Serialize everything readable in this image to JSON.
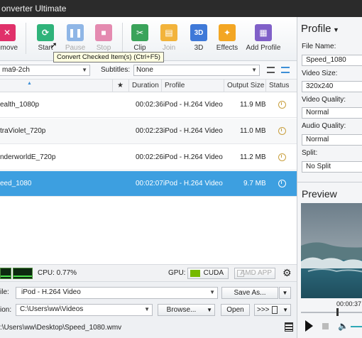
{
  "window": {
    "title": "onverter Ultimate"
  },
  "toolbar": {
    "remove": "emove",
    "start": "Start",
    "pause": "Pause",
    "stop": "Stop",
    "clip": "Clip",
    "join": "Join",
    "threed": "3D",
    "effects": "Effects",
    "add_profile": "Add Profile",
    "threed_icon_text": "3D"
  },
  "tooltip": "Convert Checked Item(s) (Ctrl+F5)",
  "filter": {
    "audio_value": "ma9-2ch",
    "subtitles_label": "Subtitles:",
    "subtitles_value": "None"
  },
  "table": {
    "headers": {
      "star": "★",
      "duration": "Duration",
      "profile": "Profile",
      "output_size": "Output Size",
      "status": "Status"
    },
    "rows": [
      {
        "name": "ealth_1080p",
        "duration": "00:02:36",
        "profile": "iPod - H.264 Video",
        "size": "11.9 MB"
      },
      {
        "name": "traViolet_720p",
        "duration": "00:02:23",
        "profile": "iPod - H.264 Video",
        "size": "11.0 MB"
      },
      {
        "name": "nderworldE_720p",
        "duration": "00:02:26",
        "profile": "iPod - H.264 Video",
        "size": "11.2 MB"
      },
      {
        "name": "eed_1080",
        "duration": "00:02:07",
        "profile": "iPod - H.264 Video",
        "size": "9.7 MB"
      }
    ]
  },
  "status": {
    "cpu": "CPU: 0.77%",
    "gpu": "GPU:",
    "cuda": "CUDA",
    "amd": "AMD APP"
  },
  "bottom": {
    "profile_label": "ile:",
    "profile_value": "iPod - H.264 Video",
    "save_as": "Save As...",
    "destination_label": "ion:",
    "destination_value": "C:\\Users\\ww\\Videos",
    "browse": "Browse...",
    "open": "Open",
    "merge": ">>>",
    "path": ":\\Users\\ww\\Desktop\\Speed_1080.wmv"
  },
  "right_panel": {
    "title": "Profile",
    "file_name_label": "File Name:",
    "file_name_value": "Speed_1080",
    "video_size_label": "Video Size:",
    "video_size_value": "320x240",
    "video_quality_label": "Video Quality:",
    "video_quality_value": "Normal",
    "audio_quality_label": "Audio Quality:",
    "audio_quality_value": "Normal",
    "split_label": "Split:",
    "split_value": "No Split",
    "preview_title": "Preview",
    "time": "00:00:37"
  },
  "colors": {
    "selected_row": "#3d9fe0",
    "accent_green": "#2fa84f",
    "accent_blue": "#4a90d9"
  }
}
